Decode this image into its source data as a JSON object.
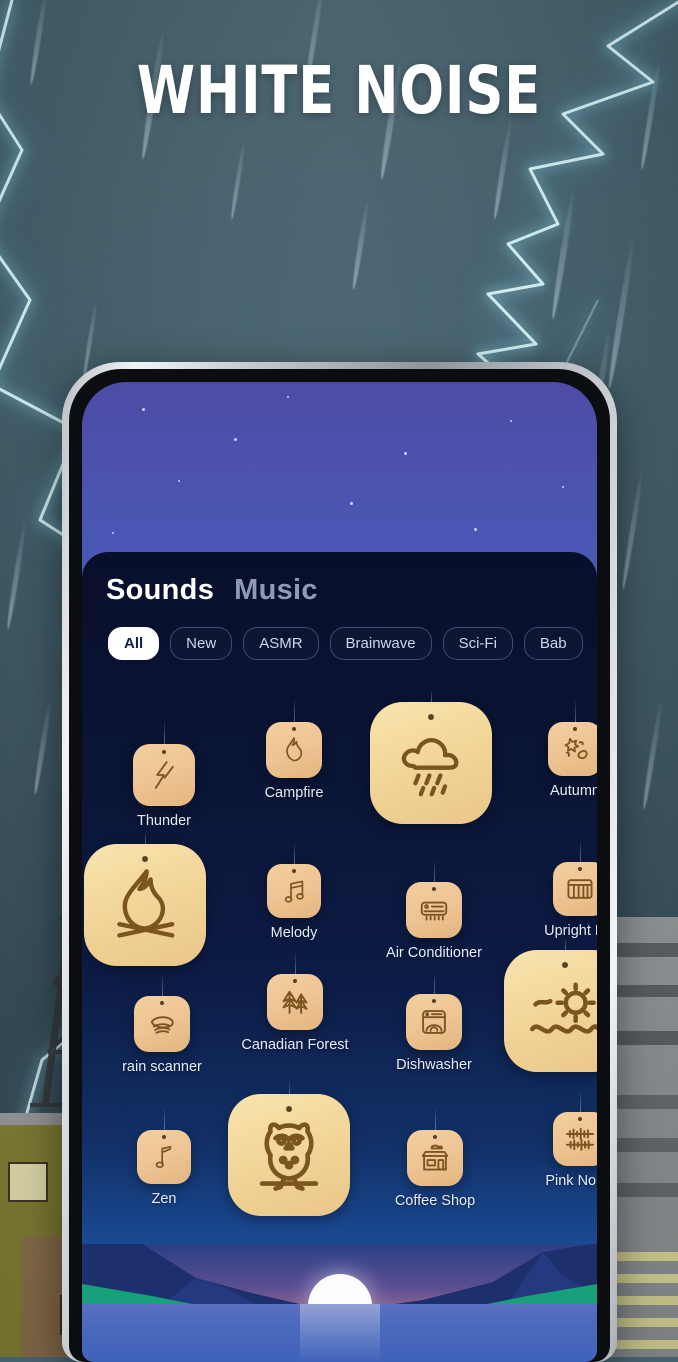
{
  "poster": {
    "title": "WHITE NOISE",
    "background": {
      "description": "stormy night sky with lightning and rain over a city",
      "sky_color": "#42606d",
      "lightning_color": "#ddfaff"
    }
  },
  "phone": {
    "frame_color": "#cfd3d8",
    "screen_background": "#3f63bd"
  },
  "app": {
    "tabs": [
      {
        "label": "Sounds",
        "active": true
      },
      {
        "label": "Music",
        "active": false
      }
    ],
    "filters": [
      {
        "label": "All",
        "active": true
      },
      {
        "label": "New",
        "active": false
      },
      {
        "label": "ASMR",
        "active": false
      },
      {
        "label": "Brainwave",
        "active": false
      },
      {
        "label": "Sci-Fi",
        "active": false
      },
      {
        "label": "Bab",
        "active": false
      }
    ],
    "accent_color": "#f3d69a",
    "card_color": "#0a1434",
    "sounds": [
      {
        "label": "Thunder",
        "icon": "thunder-icon",
        "size": "small",
        "featured": false
      },
      {
        "label": "Campfire",
        "icon": "campfire-icon",
        "size": "small",
        "featured": false
      },
      {
        "label": "",
        "icon": "rain-cloud-icon",
        "size": "large",
        "featured": true
      },
      {
        "label": "Autumn",
        "icon": "autumn-leaf-icon",
        "size": "small",
        "featured": false
      },
      {
        "label": "",
        "icon": "campfire-icon",
        "size": "large",
        "featured": true
      },
      {
        "label": "Melody",
        "icon": "music-notes-icon",
        "size": "small",
        "featured": false
      },
      {
        "label": "Air Conditioner",
        "icon": "air-conditioner-icon",
        "size": "small",
        "featured": false
      },
      {
        "label": "Upright Pia",
        "icon": "piano-icon",
        "size": "small",
        "featured": false
      },
      {
        "label": "rain scanner",
        "icon": "brain-scanner-icon",
        "size": "small",
        "featured": false
      },
      {
        "label": "Canadian Forest",
        "icon": "forest-trees-icon",
        "size": "small",
        "featured": false
      },
      {
        "label": "Dishwasher",
        "icon": "dishwasher-icon",
        "size": "small",
        "featured": false
      },
      {
        "label": "",
        "icon": "sun-sea-icon",
        "size": "large",
        "featured": true
      },
      {
        "label": "Zen",
        "icon": "music-note-icon",
        "size": "small",
        "featured": false
      },
      {
        "label": "",
        "icon": "owl-icon",
        "size": "large",
        "featured": true
      },
      {
        "label": "Coffee Shop",
        "icon": "coffee-shop-icon",
        "size": "small",
        "featured": false
      },
      {
        "label": "Pink Noise",
        "icon": "waveform-icon",
        "size": "small",
        "featured": false
      }
    ],
    "scene": {
      "description": "night lake with setting moon, mountains and green hills",
      "moon_color": "#fdfdfd",
      "water_color": "#4a69bd"
    }
  }
}
